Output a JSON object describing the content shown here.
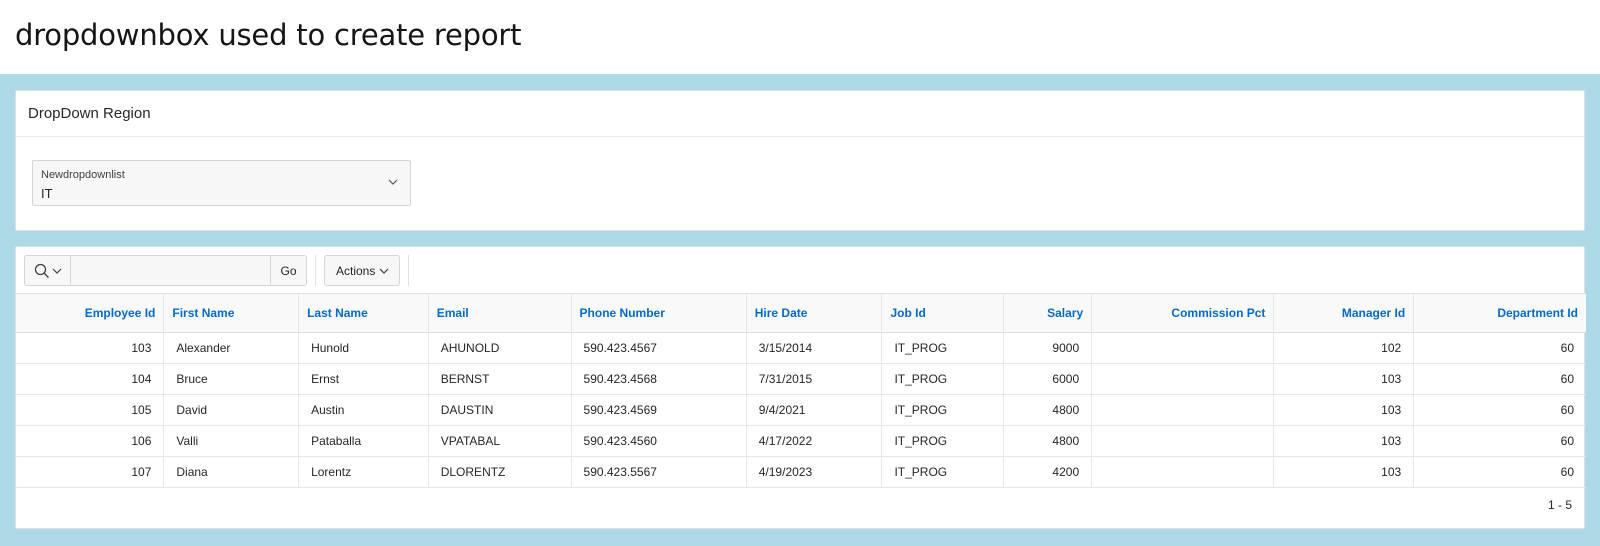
{
  "page": {
    "title": "dropdownbox used to create report"
  },
  "dropdown_region": {
    "title": "DropDown Region",
    "field": {
      "label": "Newdropdownlist",
      "value": "IT"
    }
  },
  "report": {
    "toolbar": {
      "search_value": "",
      "go_label": "Go",
      "actions_label": "Actions"
    },
    "columns": [
      "Employee Id",
      "First Name",
      "Last Name",
      "Email",
      "Phone Number",
      "Hire Date",
      "Job Id",
      "Salary",
      "Commission Pct",
      "Manager Id",
      "Department Id"
    ],
    "rows": [
      [
        "103",
        "Alexander",
        "Hunold",
        "AHUNOLD",
        "590.423.4567",
        "3/15/2014",
        "IT_PROG",
        "9000",
        "",
        "102",
        "60"
      ],
      [
        "104",
        "Bruce",
        "Ernst",
        "BERNST",
        "590.423.4568",
        "7/31/2015",
        "IT_PROG",
        "6000",
        "",
        "103",
        "60"
      ],
      [
        "105",
        "David",
        "Austin",
        "DAUSTIN",
        "590.423.4569",
        "9/4/2021",
        "IT_PROG",
        "4800",
        "",
        "103",
        "60"
      ],
      [
        "106",
        "Valli",
        "Pataballa",
        "VPATABAL",
        "590.423.4560",
        "4/17/2022",
        "IT_PROG",
        "4800",
        "",
        "103",
        "60"
      ],
      [
        "107",
        "Diana",
        "Lorentz",
        "DLORENTZ",
        "590.423.5567",
        "4/19/2023",
        "IT_PROG",
        "4200",
        "",
        "103",
        "60"
      ]
    ],
    "pagination": "1 - 5"
  },
  "icons": {
    "search": "search-icon",
    "chevron": "chevron-down-icon"
  },
  "colors": {
    "body_background": "#add8e6",
    "header_link": "#056ac8"
  }
}
